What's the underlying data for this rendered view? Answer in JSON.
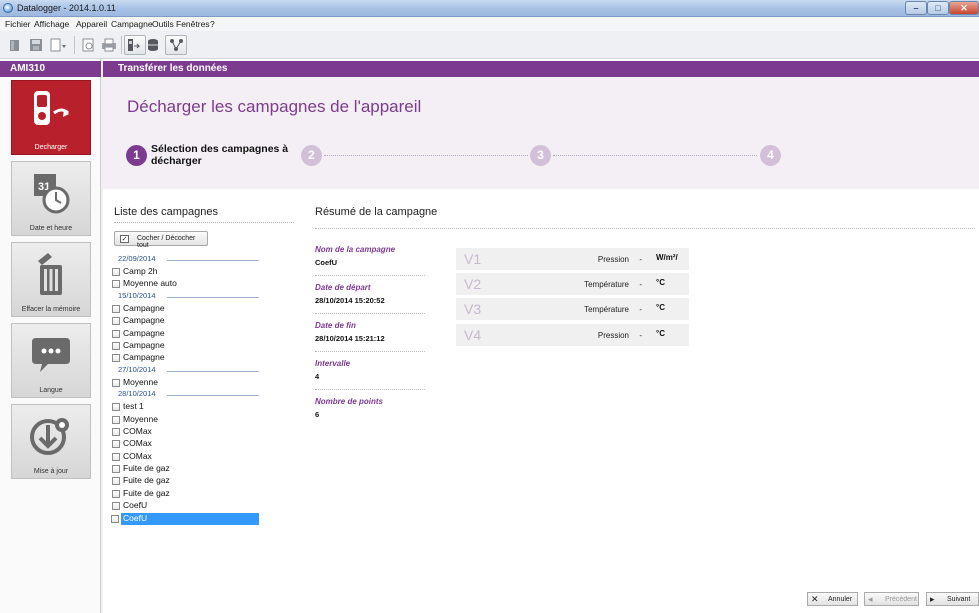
{
  "window": {
    "title": "Datalogger - 2014.1.0.11"
  },
  "menu": [
    "Fichier",
    "Affichage",
    "Appareil",
    "Campagne",
    "Outils",
    "Fenêtres",
    "?"
  ],
  "sidebar": {
    "device": "AMI310",
    "items": [
      {
        "label": "Decharger",
        "icon": "device-download-icon",
        "active": true
      },
      {
        "label": "Date et heure",
        "icon": "calendar-clock-icon",
        "active": false
      },
      {
        "label": "Effacer la mémoire",
        "icon": "trash-icon",
        "active": false
      },
      {
        "label": "Langue",
        "icon": "speech-bubble-icon",
        "active": false
      },
      {
        "label": "Mise à jour",
        "icon": "update-icon",
        "active": false
      }
    ]
  },
  "main": {
    "section_title": "Transférer les données",
    "wizard_title": "Décharger les campagnes de l'appareil",
    "steps": [
      {
        "number": "1",
        "label_line1": "Sélection des campagnes à",
        "label_line2": "décharger"
      },
      {
        "number": "2"
      },
      {
        "number": "3"
      },
      {
        "number": "4"
      }
    ]
  },
  "campaigns": {
    "title": "Liste des campagnes",
    "toggle_all_label": "Cocher / Décocher tout",
    "groups": [
      {
        "date": "22/09/2014",
        "items": [
          "Camp 2h",
          "Moyenne auto"
        ]
      },
      {
        "date": "15/10/2014",
        "items": [
          "Campagne",
          "Campagne",
          "Campagne",
          "Campagne",
          "Campagne"
        ]
      },
      {
        "date": "27/10/2014",
        "items": [
          "Moyenne"
        ]
      },
      {
        "date": "28/10/2014",
        "items": [
          "test 1",
          "Moyenne",
          "COMax",
          "COMax",
          "COMax",
          "Fuite de gaz",
          "Fuite de gaz",
          "Fuite de gaz",
          "CoefU",
          "CoefU"
        ]
      }
    ]
  },
  "summary": {
    "title": "Résumé de la campagne",
    "fields": [
      {
        "label": "Nom de la campagne",
        "value": "CoefU"
      },
      {
        "label": "Date de départ",
        "value": "28/10/2014 15:20:52"
      },
      {
        "label": "Date de fin",
        "value": "28/10/2014 15:21:12"
      },
      {
        "label": "Intervalle",
        "value": "4"
      },
      {
        "label": "Nombre de points",
        "value": "6"
      }
    ],
    "channels": [
      {
        "id": "V1",
        "param": "Pression",
        "dash": "-",
        "unit": "W/m²/"
      },
      {
        "id": "V2",
        "param": "Température",
        "dash": "-",
        "unit": "°C"
      },
      {
        "id": "V3",
        "param": "Température",
        "dash": "-",
        "unit": "°C"
      },
      {
        "id": "V4",
        "param": "Pression",
        "dash": "-",
        "unit": "°C"
      }
    ]
  },
  "footer": {
    "cancel": "Annuler",
    "previous": "Précédent",
    "next": "Suivant"
  },
  "colors": {
    "accent": "#7d3b8f",
    "active_tile": "#b8202c",
    "selection": "#3399ff"
  }
}
